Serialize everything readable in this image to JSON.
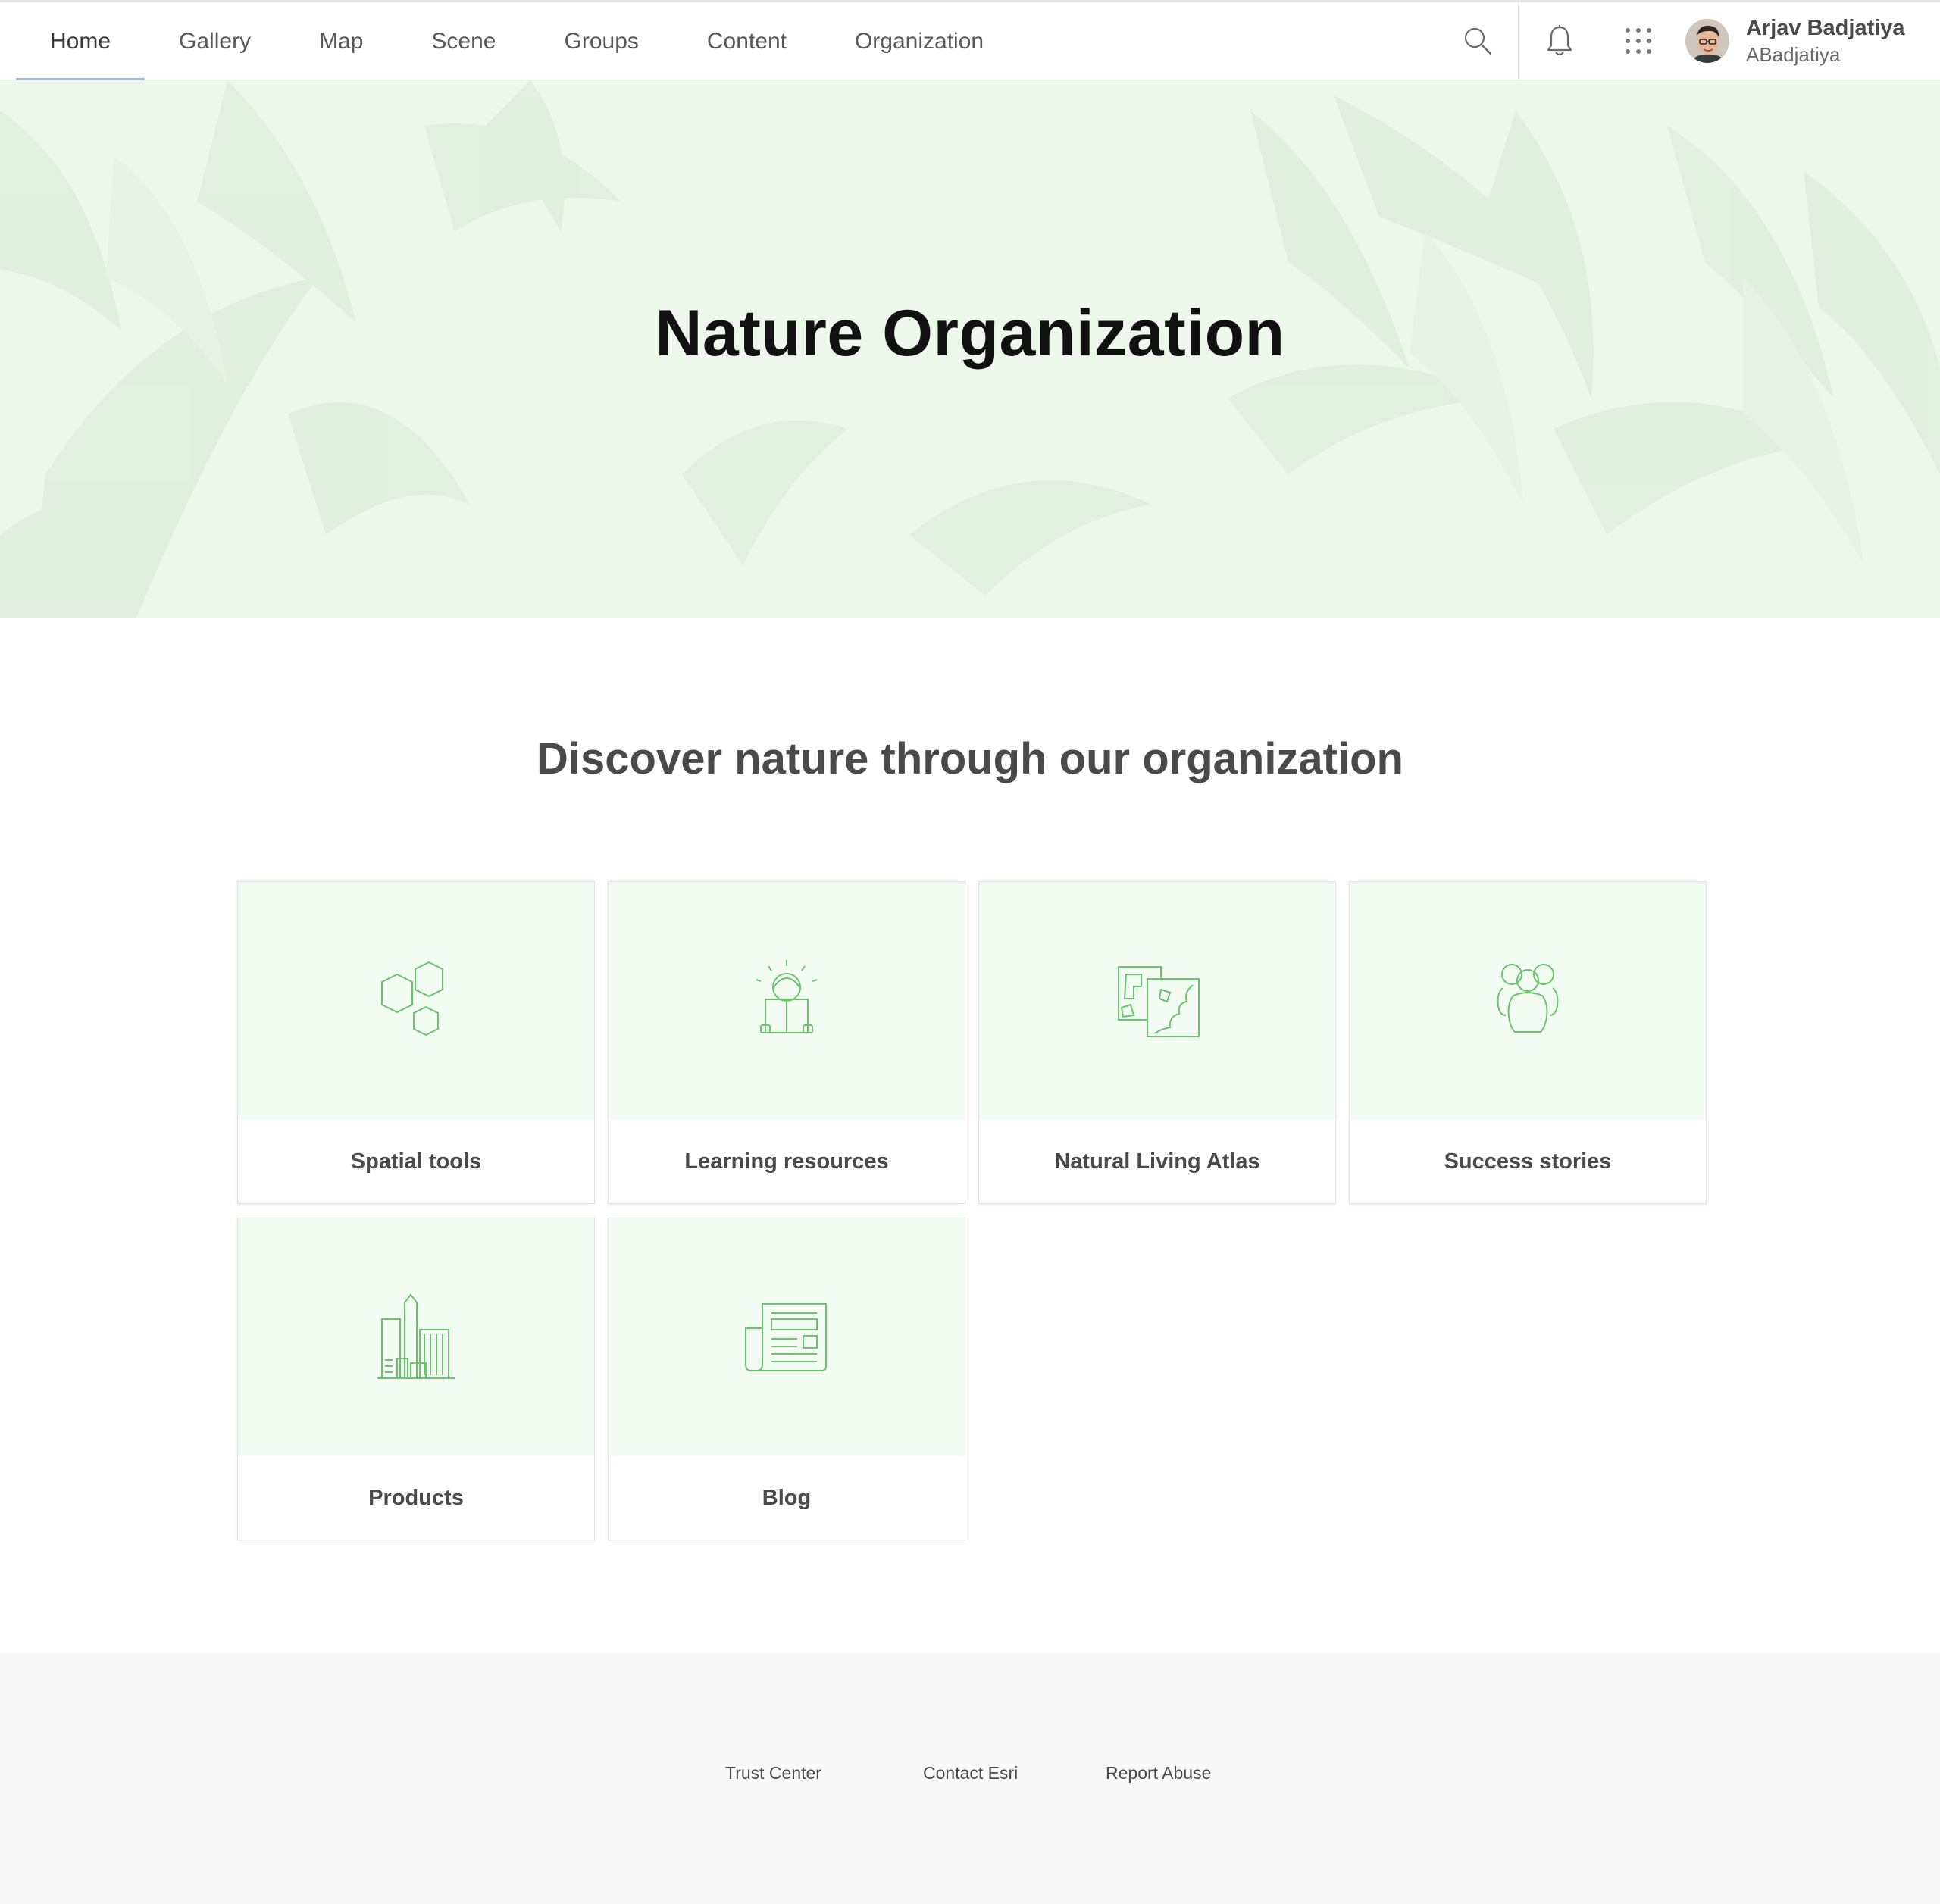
{
  "nav": {
    "tabs": [
      {
        "label": "Home",
        "active": true
      },
      {
        "label": "Gallery",
        "active": false
      },
      {
        "label": "Map",
        "active": false
      },
      {
        "label": "Scene",
        "active": false
      },
      {
        "label": "Groups",
        "active": false
      },
      {
        "label": "Content",
        "active": false
      },
      {
        "label": "Organization",
        "active": false
      }
    ],
    "icons": [
      "search-icon",
      "bell-icon",
      "app-launcher-icon"
    ]
  },
  "user": {
    "name": "Arjav Badjatiya",
    "handle": "ABadjatiya"
  },
  "hero": {
    "title": "Nature Organization"
  },
  "main": {
    "heading": "Discover nature through our organization",
    "cards": [
      {
        "label": "Spatial tools",
        "icon": "hexagons-icon"
      },
      {
        "label": "Learning resources",
        "icon": "reading-person-icon"
      },
      {
        "label": "Natural Living Atlas",
        "icon": "maps-icon"
      },
      {
        "label": "Success stories",
        "icon": "people-icon"
      },
      {
        "label": "Products",
        "icon": "buildings-icon"
      },
      {
        "label": "Blog",
        "icon": "newspaper-icon"
      }
    ]
  },
  "footer": {
    "links": [
      "Trust Center",
      "Contact Esri",
      "Report Abuse"
    ]
  },
  "colors": {
    "accent_green": "#6bc46d",
    "hero_bg": "#eef7ec",
    "card_bg": "#f3fcf3",
    "tab_underline": "#9cc0e4"
  }
}
